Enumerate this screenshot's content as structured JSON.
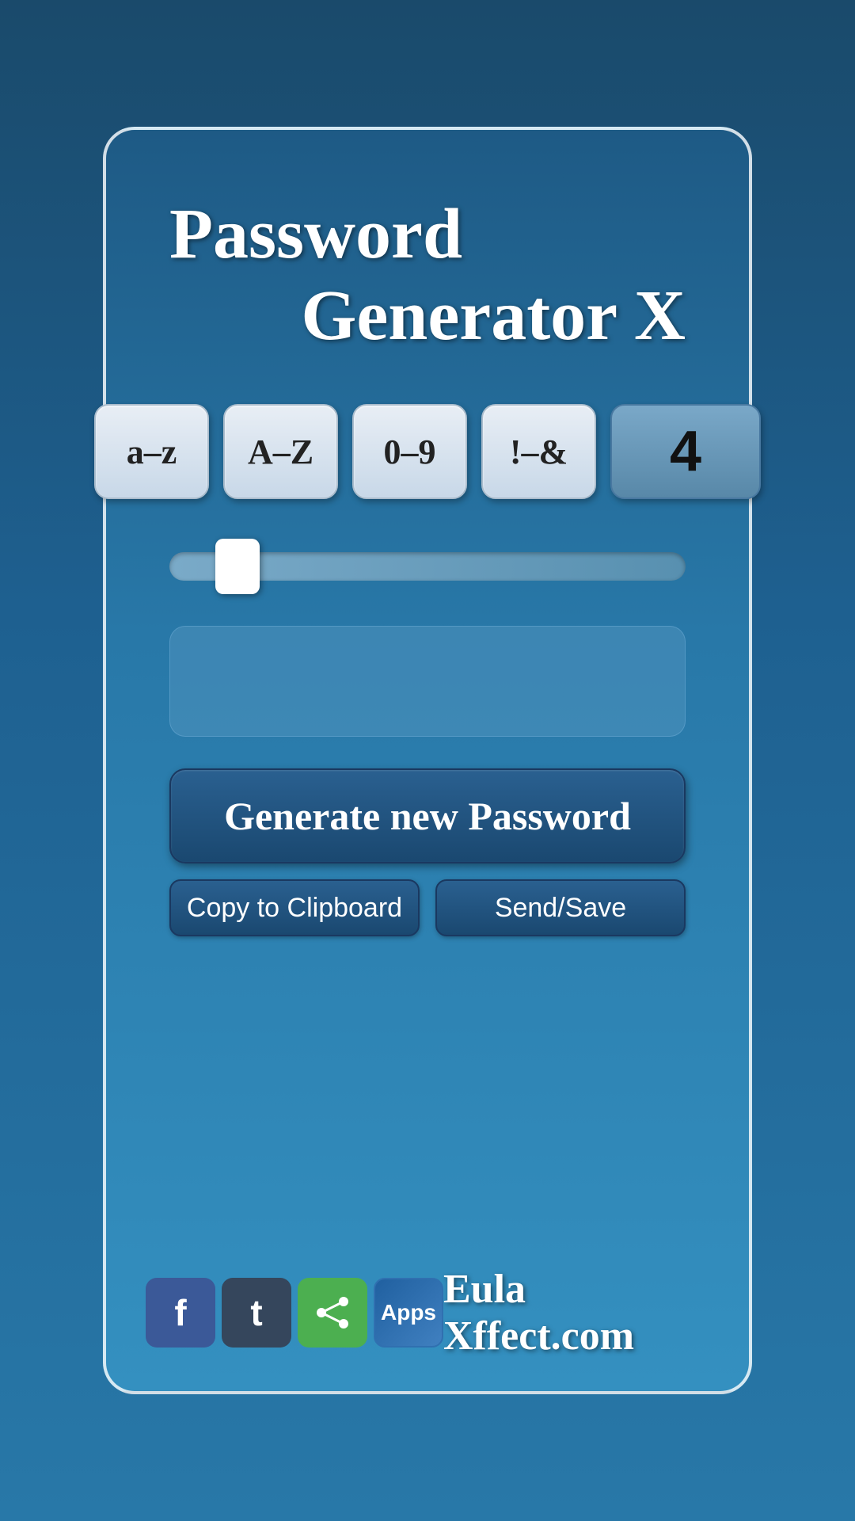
{
  "app": {
    "title_line1": "Password",
    "title_line2": "Generator X",
    "brand": "Eula Xffect.com"
  },
  "charset_buttons": [
    {
      "id": "az",
      "label": "a–z"
    },
    {
      "id": "AZ",
      "label": "A–Z"
    },
    {
      "id": "09",
      "label": "0–9"
    },
    {
      "id": "special",
      "label": "!–&"
    }
  ],
  "count_button": {
    "value": "4"
  },
  "slider": {
    "min": 1,
    "max": 32,
    "value": 4
  },
  "password_display": {
    "placeholder": "",
    "value": ""
  },
  "buttons": {
    "generate": "Generate new Password",
    "copy": "Copy to Clipboard",
    "send": "Send/Save"
  },
  "social": {
    "facebook": "f",
    "tumblr": "t",
    "share": "⋮",
    "apps": "Apps"
  },
  "colors": {
    "background": "#1a4a6b",
    "card": "#2878a8",
    "button_dark": "#1a4870",
    "facebook": "#3b5998",
    "tumblr": "#35465c",
    "share_green": "#4caf50"
  }
}
